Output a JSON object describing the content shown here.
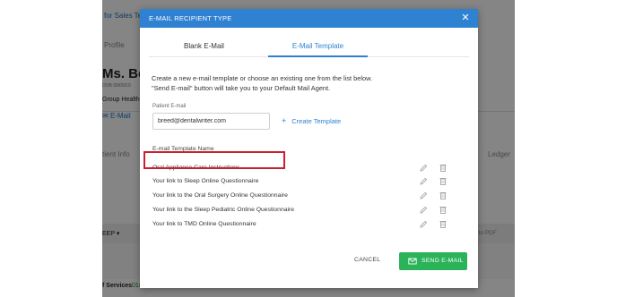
{
  "background": {
    "team_label": "for Sales Tea",
    "profile_label": "Profile",
    "patient_name": "Ms. Bec",
    "dob_text": "DOB 09/09/19",
    "group_label": "Group Health",
    "email_link": "E-Mail",
    "patient_info_label": "tient Info",
    "ledger_label": "Ledger",
    "sleep_dropdown": "EEP",
    "to_pdf_label": "t to PDF",
    "services_label": "f Services",
    "services_date": "01/10/2020"
  },
  "modal": {
    "title": "E-MAIL RECIPIENT TYPE",
    "tabs": [
      {
        "label": "Blank E-Mail",
        "active": false
      },
      {
        "label": "E-Mail Template",
        "active": true
      }
    ],
    "description_line1": "Create a new e-mail template or choose an existing one from the list below.",
    "description_line2": "\"Send E-mail\" button will take you to your Default Mail Agent.",
    "patient_email_label": "Patient E-mail",
    "patient_email_value": "breed@dentalwriter.com",
    "create_template_label": "Create Template",
    "template_list_header": "E-mail Template Name",
    "templates": [
      {
        "name": "Oral Appliance Care Instructions",
        "highlighted": true
      },
      {
        "name": "Your link to Sleep Online Questionnaire",
        "highlighted": false
      },
      {
        "name": "Your link to the Oral Surgery Online Questionnaire",
        "highlighted": false
      },
      {
        "name": "Your link to the Sleep Pediatric Online Questionnaire",
        "highlighted": false
      },
      {
        "name": "Your link to TMD Online Questionnaire",
        "highlighted": false
      }
    ],
    "cancel_label": "CANCEL",
    "send_label": "SEND E-MAIL"
  },
  "colors": {
    "header_blue": "#2f82d1",
    "send_green": "#2bb35a",
    "highlight_red": "#c8202f"
  },
  "icons": [
    "close-icon",
    "plus-icon",
    "pencil-icon",
    "trash-icon",
    "envelope-icon"
  ]
}
